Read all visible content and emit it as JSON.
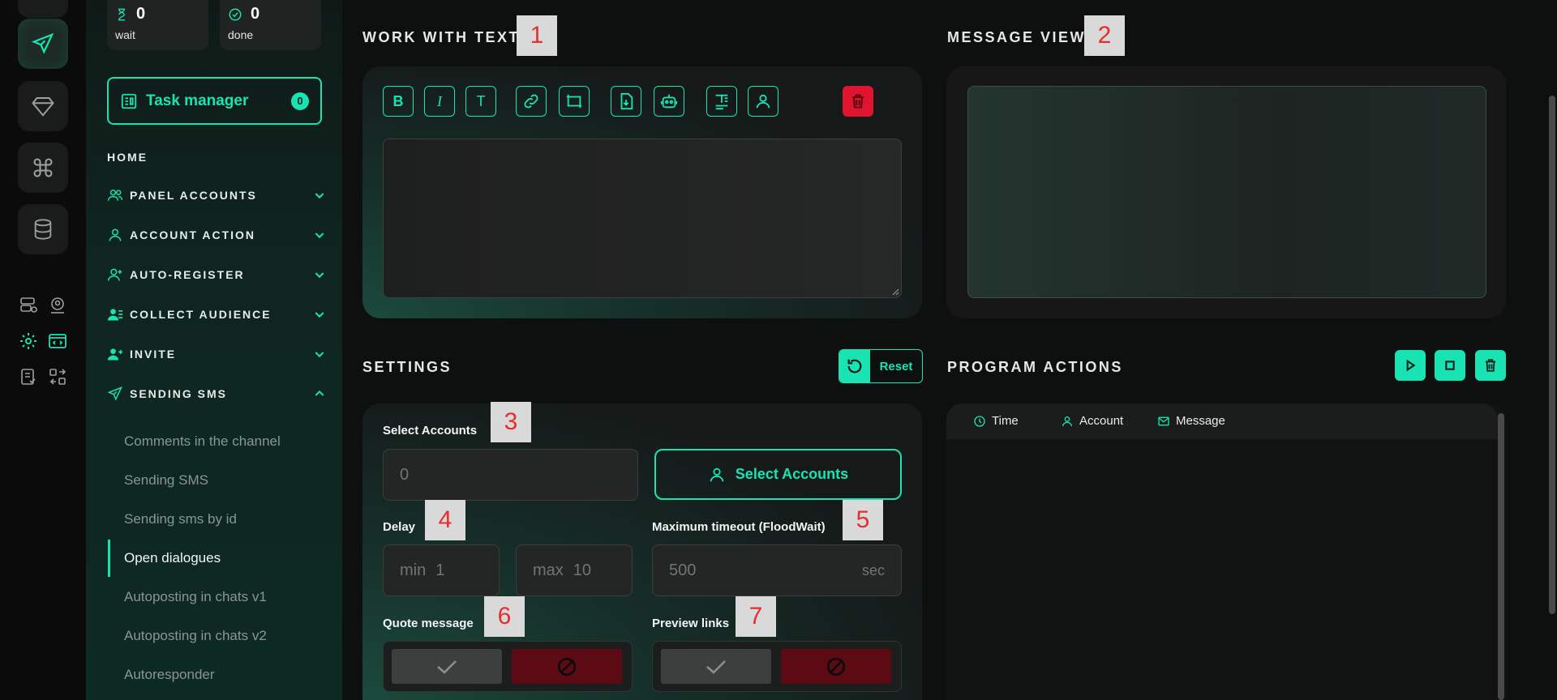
{
  "stats": {
    "wait": {
      "count": "0",
      "label": "wait"
    },
    "done": {
      "count": "0",
      "label": "done"
    }
  },
  "task_manager": {
    "label": "Task manager",
    "badge": "0"
  },
  "nav": {
    "home": "HOME",
    "items": [
      {
        "label": "PANEL ACCOUNTS",
        "icon": "users-icon",
        "expanded": false
      },
      {
        "label": "ACCOUNT ACTION",
        "icon": "user-icon",
        "expanded": false
      },
      {
        "label": "AUTO-REGISTER",
        "icon": "user-plus-icon",
        "expanded": false
      },
      {
        "label": "COLLECT AUDIENCE",
        "icon": "user-list-icon",
        "expanded": false
      },
      {
        "label": "INVITE",
        "icon": "user-invite-icon",
        "expanded": false
      },
      {
        "label": "SENDING SMS",
        "icon": "send-icon",
        "expanded": true
      }
    ],
    "sub_items": [
      "Comments in the channel",
      "Sending SMS",
      "Sending sms by id",
      "Open dialogues",
      "Autoposting in chats v1",
      "Autoposting in chats v2",
      "Autoresponder"
    ],
    "active_sub": "Open dialogues"
  },
  "work_with_text": {
    "title": "WORK WITH TEXT",
    "tag": "1"
  },
  "message_view": {
    "title": "MESSAGE VIEW",
    "tag": "2"
  },
  "toolbar": {
    "bold": "B",
    "italic": "I",
    "text": "T"
  },
  "settings": {
    "title": "SETTINGS",
    "reset_label": "Reset",
    "select_accounts_label": "Select Accounts",
    "select_accounts_tag": "3",
    "accounts_value": "0",
    "select_accounts_button": "Select Accounts",
    "delay_label": "Delay",
    "delay_tag": "4",
    "delay_min_prefix": "min",
    "delay_min_value": "1",
    "delay_max_prefix": "max",
    "delay_max_value": "10",
    "timeout_label": "Maximum timeout (FloodWait)",
    "timeout_tag": "5",
    "timeout_value": "500",
    "timeout_unit": "sec",
    "quote_label": "Quote message",
    "quote_tag": "6",
    "preview_label": "Preview links",
    "preview_tag": "7"
  },
  "program_actions": {
    "title": "PROGRAM ACTIONS",
    "columns": [
      "Time",
      "Account",
      "Message"
    ]
  },
  "colors": {
    "accent": "#19e3b2",
    "danger": "#e0142e",
    "tag_text": "#e52e2e"
  }
}
